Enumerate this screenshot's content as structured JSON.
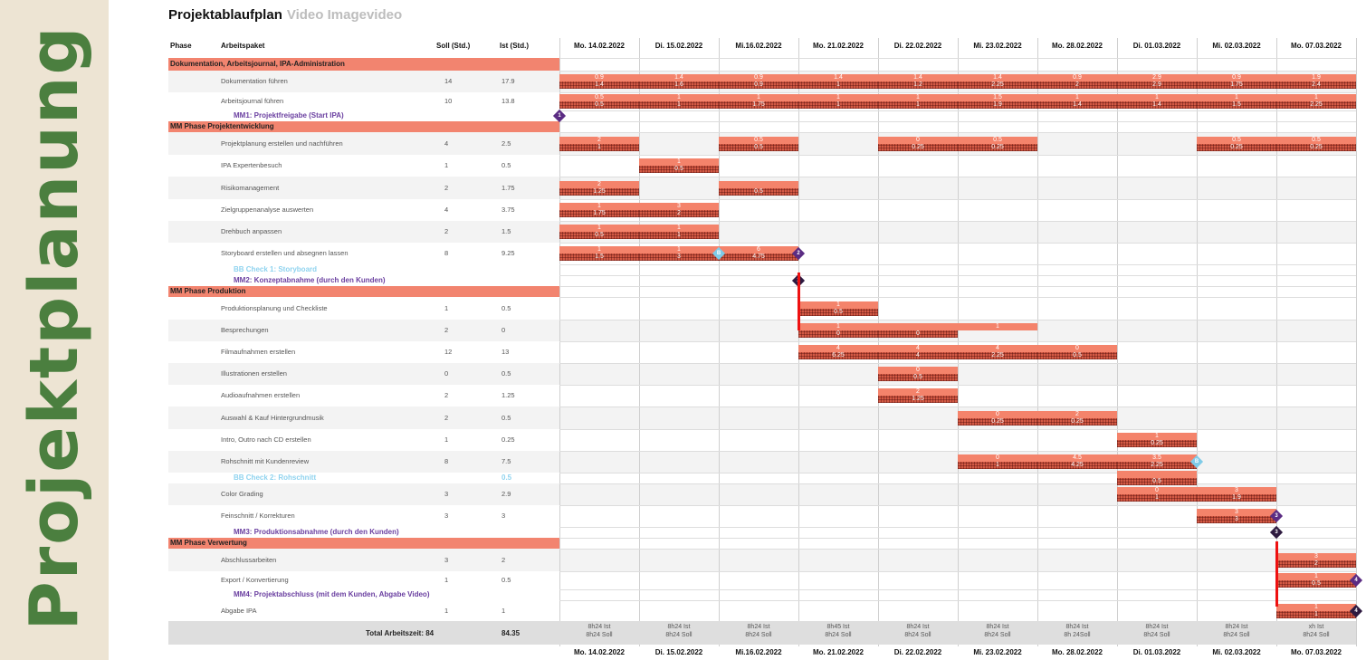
{
  "side_title": "Projektplanung",
  "title": {
    "main": "Projektablaufplan",
    "sub": "Video Imagevideo"
  },
  "headers": {
    "phase": "Phase",
    "work": "Arbeitspaket",
    "soll": "Soll (Std.)",
    "ist": "Ist (Std.)"
  },
  "dates": [
    "Mo. 14.02.2022",
    "Di. 15.02.2022",
    "Mi.16.02.2022",
    "Mo. 21.02.2022",
    "Di. 22.02.2022",
    "Mi. 23.02.2022",
    "Mo. 28.02.2022",
    "Di. 01.03.2022",
    "Mi.  02.03.2022",
    "Mo. 07.03.2022"
  ],
  "rows": [
    {
      "t": "sec",
      "label": "Dokumentation, Arbeitsjournal, IPA-Administration"
    },
    {
      "t": "task",
      "label": "Dokumentation führen",
      "soll": "14",
      "ist": "17.9"
    },
    {
      "t": "task",
      "label": "Arbeitsjournal führen",
      "soll": "10",
      "ist": "13.8"
    },
    {
      "t": "ms",
      "label": "MM1: Projektfreigabe (Start IPA)"
    },
    {
      "t": "sec",
      "label": "MM Phase Projektentwicklung"
    },
    {
      "t": "task",
      "label": "Projektplanung erstellen und nachführen",
      "soll": "4",
      "ist": "2.5"
    },
    {
      "t": "task",
      "label": "IPA Expertenbesuch",
      "soll": "1",
      "ist": "0.5"
    },
    {
      "t": "task",
      "label": "Risikomanagement",
      "soll": "2",
      "ist": "1.75"
    },
    {
      "t": "task",
      "label": "Zielgruppenanalyse auswerten",
      "soll": "4",
      "ist": "3.75"
    },
    {
      "t": "task",
      "label": "Drehbuch anpassen",
      "soll": "2",
      "ist": "1.5"
    },
    {
      "t": "task",
      "label": "Storyboard erstellen und absegnen lassen",
      "soll": "8",
      "ist": "9.25"
    },
    {
      "t": "bb",
      "label": "BB Check 1: Storyboard"
    },
    {
      "t": "ms",
      "label": "MM2: Konzeptabnahme (durch den Kunden)"
    },
    {
      "t": "sec",
      "label": "MM Phase Produktion"
    },
    {
      "t": "task",
      "label": "Produktionsplanung und Checkliste",
      "soll": "1",
      "ist": "0.5"
    },
    {
      "t": "task",
      "label": "Besprechungen",
      "soll": "2",
      "ist": "0"
    },
    {
      "t": "task",
      "label": "Filmaufnahmen erstellen",
      "soll": "12",
      "ist": "13"
    },
    {
      "t": "task",
      "label": "Illustrationen erstellen",
      "soll": "0",
      "ist": "0.5"
    },
    {
      "t": "task",
      "label": "Audioaufnahmen erstellen",
      "soll": "2",
      "ist": "1.25"
    },
    {
      "t": "task",
      "label": "Auswahl & Kauf Hintergrundmusik",
      "soll": "2",
      "ist": "0.5"
    },
    {
      "t": "task",
      "label": "Intro, Outro nach CD erstellen",
      "soll": "1",
      "ist": "0.25"
    },
    {
      "t": "task",
      "label": "Rohschnitt mit Kundenreview",
      "soll": "8",
      "ist": "7.5"
    },
    {
      "t": "bb",
      "label": "BB Check 2: Rohschnitt",
      "ist": "0.5"
    },
    {
      "t": "task",
      "label": "Color Grading",
      "soll": "3",
      "ist": "2.9"
    },
    {
      "t": "task",
      "label": "Feinschnitt / Korrekturen",
      "soll": "3",
      "ist": "3"
    },
    {
      "t": "ms",
      "label": "MM3: Produktionsabnahme (durch den Kunden)"
    },
    {
      "t": "sec",
      "label": "MM Phase Verwertung"
    },
    {
      "t": "task",
      "label": "Abschlussarbeiten",
      "soll": "3",
      "ist": "2"
    },
    {
      "t": "task",
      "label": "Export / Konvertierung",
      "soll": "1",
      "ist": "0.5"
    },
    {
      "t": "ms",
      "label": "MM4: Projektabschluss (mit dem Kunden, Abgabe Video)"
    },
    {
      "t": "task",
      "label": "Abgabe IPA",
      "soll": "1",
      "ist": "1"
    }
  ],
  "bars": [
    {
      "r": 1,
      "d": 0,
      "soll": "0.9",
      "ist": "1.4"
    },
    {
      "r": 1,
      "d": 1,
      "soll": "1.4",
      "ist": "1.6"
    },
    {
      "r": 1,
      "d": 2,
      "soll": "0.9",
      "ist": "0.9"
    },
    {
      "r": 1,
      "d": 3,
      "soll": "1.4",
      "ist": "1"
    },
    {
      "r": 1,
      "d": 4,
      "soll": "1.4",
      "ist": "1.2"
    },
    {
      "r": 1,
      "d": 5,
      "soll": "1.4",
      "ist": "2.25"
    },
    {
      "r": 1,
      "d": 6,
      "soll": "0.9",
      "ist": "2"
    },
    {
      "r": 1,
      "d": 7,
      "soll": "2.9",
      "ist": "2.9"
    },
    {
      "r": 1,
      "d": 8,
      "soll": "0.9",
      "ist": "1.75"
    },
    {
      "r": 1,
      "d": 9,
      "soll": "1.9",
      "ist": "2.4"
    },
    {
      "r": 2,
      "d": 0,
      "soll": "0.5",
      "ist": "0.5"
    },
    {
      "r": 2,
      "d": 1,
      "soll": "1",
      "ist": "1"
    },
    {
      "r": 2,
      "d": 2,
      "soll": "1",
      "ist": "1.75"
    },
    {
      "r": 2,
      "d": 3,
      "soll": "1",
      "ist": "1"
    },
    {
      "r": 2,
      "d": 4,
      "soll": "1",
      "ist": "1"
    },
    {
      "r": 2,
      "d": 5,
      "soll": "1.5",
      "ist": "1.9"
    },
    {
      "r": 2,
      "d": 6,
      "soll": "1",
      "ist": "1.4"
    },
    {
      "r": 2,
      "d": 7,
      "soll": "1",
      "ist": "1.4"
    },
    {
      "r": 2,
      "d": 8,
      "soll": "1",
      "ist": "1.5"
    },
    {
      "r": 2,
      "d": 9,
      "soll": "1",
      "ist": "2.25"
    },
    {
      "r": 5,
      "d": 0,
      "soll": "2",
      "ist": "1"
    },
    {
      "r": 5,
      "d": 2,
      "soll": "0.5",
      "ist": "0.5"
    },
    {
      "r": 5,
      "d": 4,
      "soll": "0",
      "ist": "0.25"
    },
    {
      "r": 5,
      "d": 5,
      "soll": "0.5",
      "ist": "0.25"
    },
    {
      "r": 5,
      "d": 8,
      "soll": "0.5",
      "ist": "0.25"
    },
    {
      "r": 5,
      "d": 9,
      "soll": "0.5",
      "ist": "0.25"
    },
    {
      "r": 6,
      "d": 1,
      "soll": "1",
      "ist": "0.5"
    },
    {
      "r": 7,
      "d": 0,
      "soll": "2",
      "ist": "1.25"
    },
    {
      "r": 7,
      "d": 2,
      "soll": "",
      "ist": "0.5"
    },
    {
      "r": 8,
      "d": 0,
      "soll": "1",
      "ist": "1.75"
    },
    {
      "r": 8,
      "d": 1,
      "soll": "3",
      "ist": "2"
    },
    {
      "r": 9,
      "d": 0,
      "soll": "1",
      "ist": "0.5"
    },
    {
      "r": 9,
      "d": 1,
      "soll": "1",
      "ist": "1"
    },
    {
      "r": 10,
      "d": 0,
      "soll": "1",
      "ist": "1.5"
    },
    {
      "r": 10,
      "d": 1,
      "soll": "1",
      "ist": "3"
    },
    {
      "r": 10,
      "d": 2,
      "soll": "6",
      "ist": "4.75"
    },
    {
      "r": 14,
      "d": 3,
      "soll": "1",
      "ist": "0.5"
    },
    {
      "r": 15,
      "d": 3,
      "soll": "1",
      "ist": "0"
    },
    {
      "r": 15,
      "d": 4,
      "soll": "",
      "ist": "0"
    },
    {
      "r": 15,
      "d": 5,
      "soll": "1",
      "ist": ""
    },
    {
      "r": 16,
      "d": 3,
      "soll": "4",
      "ist": "6.25"
    },
    {
      "r": 16,
      "d": 4,
      "soll": "4",
      "ist": "4"
    },
    {
      "r": 16,
      "d": 5,
      "soll": "4",
      "ist": "2.25"
    },
    {
      "r": 16,
      "d": 6,
      "soll": "0",
      "ist": "0.5"
    },
    {
      "r": 17,
      "d": 4,
      "soll": "0",
      "ist": "0.5"
    },
    {
      "r": 18,
      "d": 4,
      "soll": "2",
      "ist": "1.25"
    },
    {
      "r": 19,
      "d": 5,
      "soll": "0",
      "ist": "0.25"
    },
    {
      "r": 19,
      "d": 6,
      "soll": "2",
      "ist": "0.25"
    },
    {
      "r": 20,
      "d": 7,
      "soll": "1",
      "ist": "0.25"
    },
    {
      "r": 21,
      "d": 5,
      "soll": "0",
      "ist": "1"
    },
    {
      "r": 21,
      "d": 6,
      "soll": "4.5",
      "ist": "4.25"
    },
    {
      "r": 21,
      "d": 7,
      "soll": "3.5",
      "ist": "2.25"
    },
    {
      "r": 22,
      "d": 7,
      "soll": "",
      "ist": "0.5"
    },
    {
      "r": 23,
      "d": 7,
      "soll": "0",
      "ist": "1"
    },
    {
      "r": 23,
      "d": 8,
      "soll": "3",
      "ist": "1.9"
    },
    {
      "r": 24,
      "d": 8,
      "soll": "3",
      "ist": "3"
    },
    {
      "r": 27,
      "d": 9,
      "soll": "3",
      "ist": "2"
    },
    {
      "r": 28,
      "d": 9,
      "soll": "1",
      "ist": "0.5"
    },
    {
      "r": 30,
      "d": 9,
      "soll": "1",
      "ist": "1"
    }
  ],
  "milestones": [
    {
      "r": 3,
      "d": 0,
      "label": "1",
      "color": "#5b2c83"
    },
    {
      "r": 10,
      "d": 2,
      "label": "B",
      "color": "#7fcbe8"
    },
    {
      "r": 10,
      "d": 3,
      "label": "2",
      "color": "#5b2c83"
    },
    {
      "r": 12,
      "d": 3,
      "label": "2",
      "color": "#2e1a40"
    },
    {
      "r": 21,
      "d": 8,
      "label": "B",
      "color": "#7fcbe8"
    },
    {
      "r": 24,
      "d": 9,
      "label": "3",
      "color": "#5b2c83"
    },
    {
      "r": 25,
      "d": 9,
      "label": "3",
      "color": "#2e1a40"
    },
    {
      "r": 28,
      "d": 10,
      "label": "4",
      "color": "#5b2c83"
    },
    {
      "r": 30,
      "d": 10,
      "label": "4",
      "color": "#2e1a40"
    }
  ],
  "total": {
    "label": "Total Arbeitszeit: 84",
    "value": "84.35",
    "days": [
      {
        "ist": "8h24 Ist",
        "soll": "8h24 Soll"
      },
      {
        "ist": "8h24 Ist",
        "soll": "8h24 Soll"
      },
      {
        "ist": "8h24 Ist",
        "soll": "8h24 Soll"
      },
      {
        "ist": "8h45 Ist",
        "soll": "8h24 Soll"
      },
      {
        "ist": "8h24 Ist",
        "soll": "8h24 Soll"
      },
      {
        "ist": "8h24 Ist",
        "soll": "8h24 Soll"
      },
      {
        "ist": "8h24 Ist",
        "soll": "8h 24Soll"
      },
      {
        "ist": "8h24 Ist",
        "soll": "8h24 Soll"
      },
      {
        "ist": "8h24 Ist",
        "soll": "8h24 Soll"
      },
      {
        "ist": "xh Ist",
        "soll": "8h24 Soll"
      }
    ]
  },
  "colors": {
    "section": "#f2846f",
    "soll": "#f4836b",
    "ist": "#d45a45",
    "milestone": "#5b2c83",
    "check": "#7fcbe8",
    "title_strip": "#ede4d3",
    "title_text": "#4b7f3f"
  }
}
